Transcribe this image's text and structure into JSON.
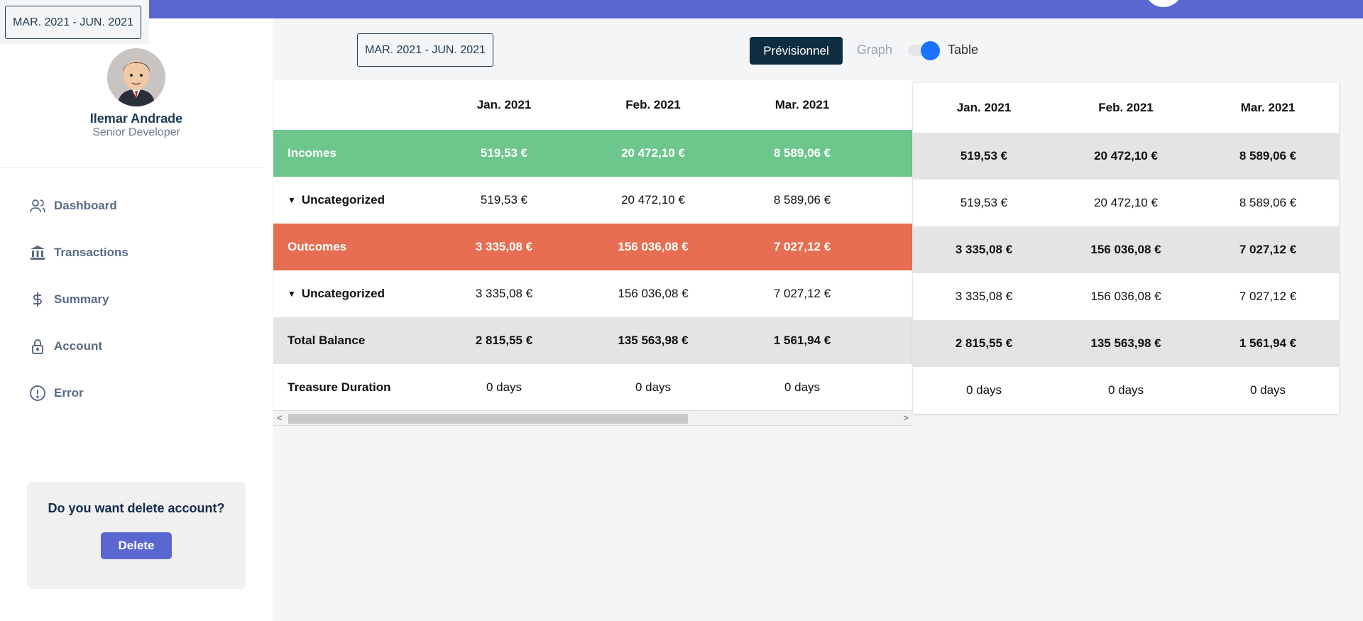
{
  "date_range": "MAR. 2021 - JUN. 2021",
  "user": {
    "name": "Ilemar Andrade",
    "role": "Senior Developer"
  },
  "nav": [
    {
      "label": "Dashboard",
      "icon": "users-icon"
    },
    {
      "label": "Transactions",
      "icon": "bank-icon"
    },
    {
      "label": "Summary",
      "icon": "dollar-icon"
    },
    {
      "label": "Account",
      "icon": "lock-icon"
    },
    {
      "label": "Error",
      "icon": "alert-circle-icon"
    }
  ],
  "delete_card": {
    "question": "Do you want delete account?",
    "button": "Delete"
  },
  "view": {
    "previsionnel": "Prévisionnel",
    "graph": "Graph",
    "table": "Table"
  },
  "columns": [
    "Jan. 2021",
    "Feb. 2021",
    "Mar. 2021"
  ],
  "table1": {
    "incomes": {
      "label": "Incomes",
      "values": [
        "519,53 €",
        "20 472,10 €",
        "8 589,06 €"
      ]
    },
    "incomes_sub": {
      "label": "Uncategorized",
      "values": [
        "519,53 €",
        "20 472,10 €",
        "8 589,06 €"
      ]
    },
    "outcomes": {
      "label": "Outcomes",
      "values": [
        "3 335,08 €",
        "156 036,08 €",
        "7 027,12 €"
      ]
    },
    "outcomes_sub": {
      "label": "Uncategorized",
      "values": [
        "3 335,08 €",
        "156 036,08 €",
        "7 027,12 €"
      ]
    },
    "total": {
      "label": "Total Balance",
      "values": [
        "2 815,55 €",
        "135 563,98 €",
        "1 561,94 €"
      ]
    },
    "treasure": {
      "label": "Treasure Duration",
      "values": [
        "0 days",
        "0 days",
        "0 days"
      ]
    }
  },
  "table2": [
    [
      "519,53 €",
      "20 472,10 €",
      "8 589,06 €"
    ],
    [
      "519,53 €",
      "20 472,10 €",
      "8 589,06 €"
    ],
    [
      "3 335,08 €",
      "156 036,08 €",
      "7 027,12 €"
    ],
    [
      "3 335,08 €",
      "156 036,08 €",
      "7 027,12 €"
    ],
    [
      "2 815,55 €",
      "135 563,98 €",
      "1 561,94 €"
    ],
    [
      "0 days",
      "0 days",
      "0 days"
    ]
  ],
  "colors": {
    "accent": "#5b67d1",
    "income": "#6dc68c",
    "outcome": "#e76e52",
    "dark": "#0f2d40",
    "toggle": "#1a73ff"
  }
}
